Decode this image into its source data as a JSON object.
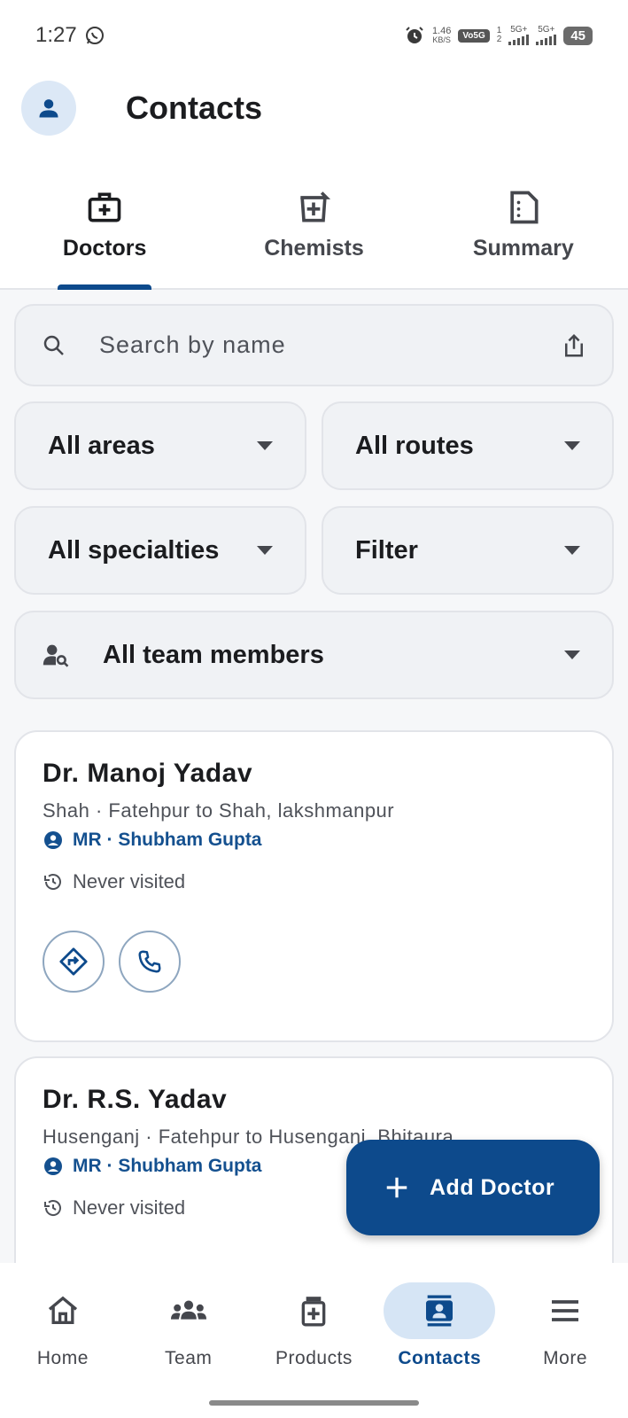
{
  "status_bar": {
    "time": "1:27",
    "net_speed_value": "1.46",
    "net_speed_unit": "KB/S",
    "volte": "Vo5G",
    "sim1": "5G+",
    "sim2": "5G+",
    "battery": "45"
  },
  "header": {
    "title": "Contacts"
  },
  "tabs": [
    {
      "label": "Doctors",
      "active": true
    },
    {
      "label": "Chemists",
      "active": false
    },
    {
      "label": "Summary",
      "active": false
    }
  ],
  "search": {
    "placeholder": "Search by name"
  },
  "filters": {
    "areas": "All areas",
    "routes": "All routes",
    "specialties": "All specialties",
    "filter": "Filter",
    "team": "All team members"
  },
  "contacts": [
    {
      "name": "Dr. Manoj Yadav",
      "address": "Shah · Fatehpur to Shah, lakshmanpur",
      "mr": "MR · Shubham Gupta",
      "visit": "Never visited"
    },
    {
      "name": "Dr. R.S. Yadav",
      "address": "Husenganj · Fatehpur to Husenganj, Bhitaura",
      "mr": "MR · Shubham Gupta",
      "visit": "Never visited"
    }
  ],
  "fab": {
    "label": "Add Doctor"
  },
  "bottom_nav": [
    {
      "label": "Home",
      "icon": "home-icon",
      "active": false
    },
    {
      "label": "Team",
      "icon": "team-icon",
      "active": false
    },
    {
      "label": "Products",
      "icon": "products-icon",
      "active": false
    },
    {
      "label": "Contacts",
      "icon": "contacts-icon",
      "active": true
    },
    {
      "label": "More",
      "icon": "menu-icon",
      "active": false
    }
  ],
  "colors": {
    "primary": "#0d4a8c",
    "active_pill": "#d6e5f5",
    "mr_text": "#14508f"
  }
}
